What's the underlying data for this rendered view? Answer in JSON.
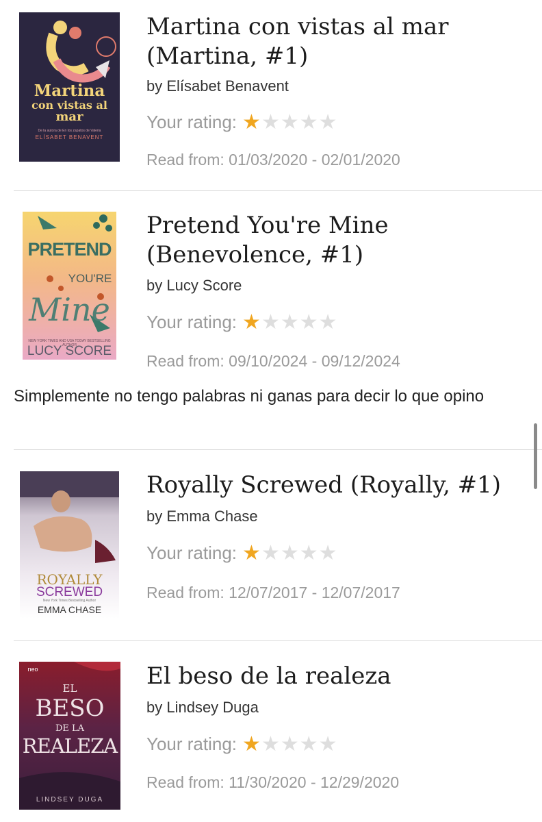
{
  "rating_label": "Your rating:",
  "books": [
    {
      "title_line1": "Martina con vistas al mar",
      "title_line2": "(Martina, #1)",
      "author": "by Elísabet Benavent",
      "rating": 1,
      "read_from": "Read from: 01/03/2020 - 02/01/2020",
      "cover_title": [
        "Martina",
        "con vistas al",
        "mar"
      ],
      "cover_author": "ELÍSABET BENAVENT",
      "cover_tagline": "De la autora de En los zapatos de Valeria"
    },
    {
      "title_line1": "Pretend You're Mine",
      "title_line2": "(Benevolence, #1)",
      "author": "by Lucy Score",
      "rating": 1,
      "read_from": "Read from: 09/10/2024 - 09/12/2024",
      "review": "Simplemente no tengo palabras ni ganas para decir lo que opino",
      "cover_title": [
        "PRETEND",
        "YOU'RE",
        "Mine"
      ],
      "cover_author": "LUCY SCORE",
      "cover_tagline": "NEW YORK TIMES AND USA TODAY BESTSELLING AUTHOR"
    },
    {
      "title_line1": "Royally Screwed (Royally, #1)",
      "author": "by Emma Chase",
      "rating": 1,
      "read_from": "Read from: 12/07/2017 - 12/07/2017",
      "cover_title": [
        "ROYALLY",
        "SCREWED"
      ],
      "cover_author": "EMMA CHASE",
      "cover_tagline": "New York Times Bestselling Author"
    },
    {
      "title_line1": "El beso de la realeza",
      "author": "by Lindsey Duga",
      "rating": 1,
      "read_from": "Read from: 11/30/2020 - 12/29/2020",
      "cover_title": [
        "EL",
        "BESO",
        "DE LA",
        "REALEZA"
      ],
      "cover_author": "LINDSEY DUGA",
      "cover_tagline": "neo"
    }
  ],
  "colors": {
    "star_filled": "#f0a620",
    "star_empty": "#dedede",
    "muted_text": "#9a9a9a",
    "divider": "#d9d9d9"
  }
}
